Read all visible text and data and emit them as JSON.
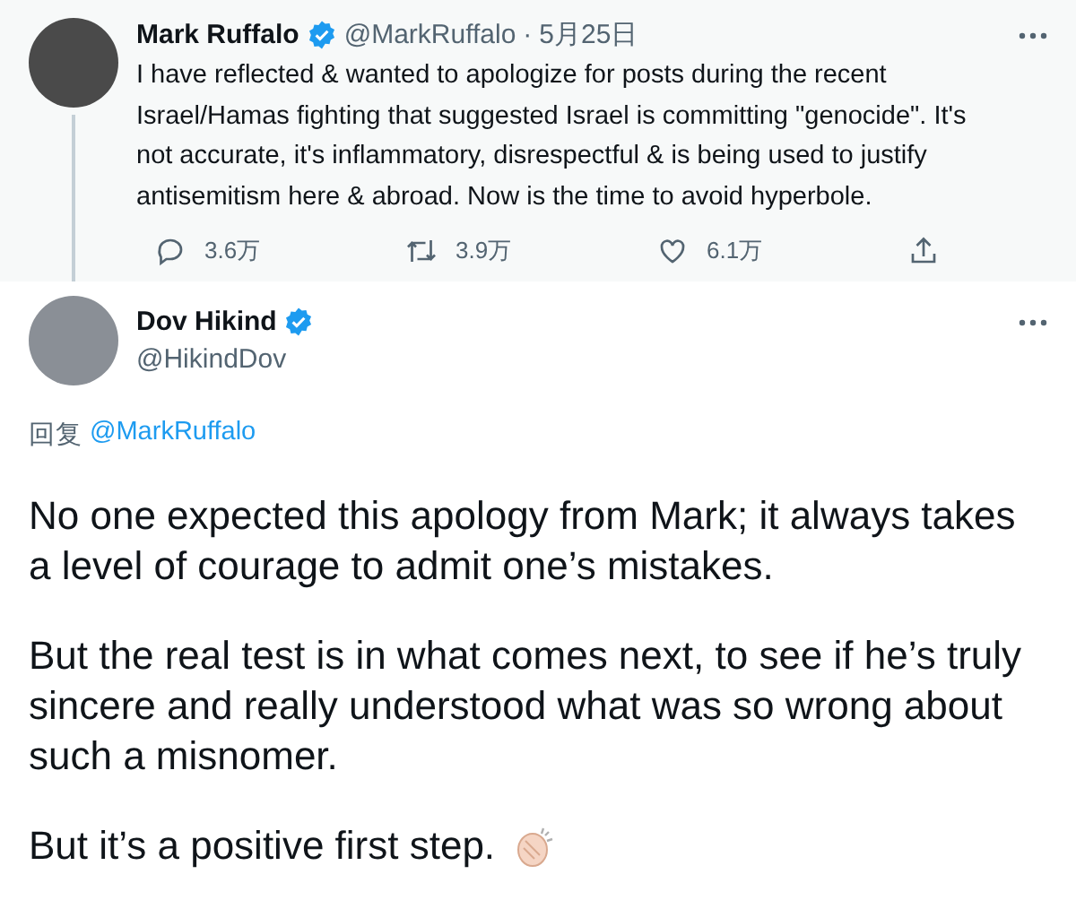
{
  "original_tweet": {
    "name": "Mark Ruffalo",
    "verified": true,
    "handle": "@MarkRuffalo",
    "separator": "·",
    "date": "5月25日",
    "text": "I have reflected & wanted to apologize for posts during the recent Israel/Hamas fighting that suggested Israel is committing \"genocide\". It's not accurate, it's inflammatory, disrespectful & is being used to justify antisemitism here & abroad. Now is the time to avoid hyperbole.",
    "actions": [
      {
        "kind": "reply",
        "count": "3.6万"
      },
      {
        "kind": "retweet",
        "count": "3.9万"
      },
      {
        "kind": "like",
        "count": "6.1万"
      },
      {
        "kind": "share"
      }
    ]
  },
  "reply_tweet": {
    "name": "Dov Hikind",
    "verified": true,
    "handle": "@HikindDov",
    "reply_prefix": "回复",
    "reply_to": "@MarkRuffalo",
    "paragraphs": [
      "No one expected this apology from Mark; it always takes a level of courage to admit one’s mistakes.",
      "But the real test is in what comes next, to see if he’s truly sincere and really understood what was so wrong about such a misnomer.",
      "But it’s a positive first step."
    ]
  }
}
